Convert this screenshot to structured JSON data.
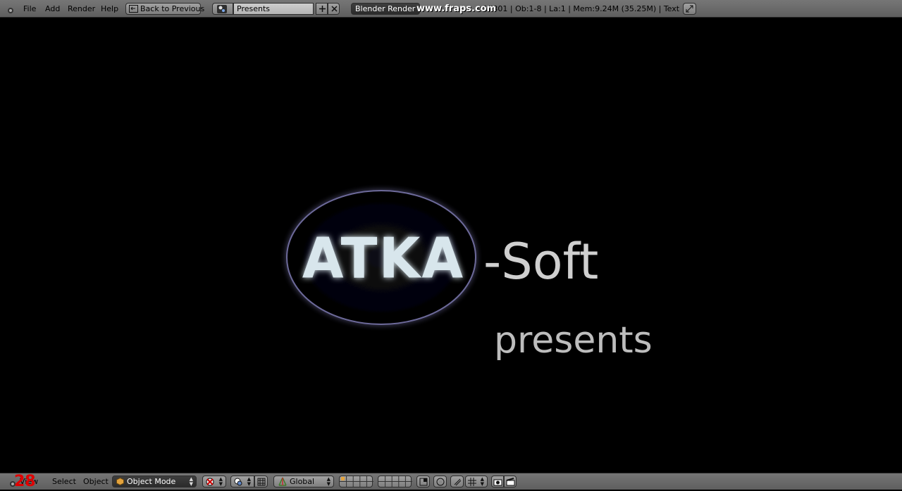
{
  "menu": {
    "file": "File",
    "add": "Add",
    "render": "Render",
    "help": "Help"
  },
  "back_button": "Back to Previous",
  "scene": {
    "name": "Presents"
  },
  "render_engine": "Blender Render",
  "watermark": "www.fraps.com",
  "stats": "s:17301 | Ob:1-8 | La:1 | Mem:9.24M (35.25M) | Text",
  "viewport": {
    "logo_text": "ATKA",
    "soft_text": "-Soft",
    "presents_text": "presents"
  },
  "fps_counter": "28",
  "bottom": {
    "view_label": "View",
    "select": "Select",
    "object": "Object",
    "mode": "Object Mode",
    "orientation": "Global"
  },
  "colors": {
    "header": "#6b6b6b",
    "fps": "#e00000",
    "logo_fill": "#d8e6ec",
    "soft_text": "#cfcfcf",
    "presents_text": "#bdbdbd"
  }
}
